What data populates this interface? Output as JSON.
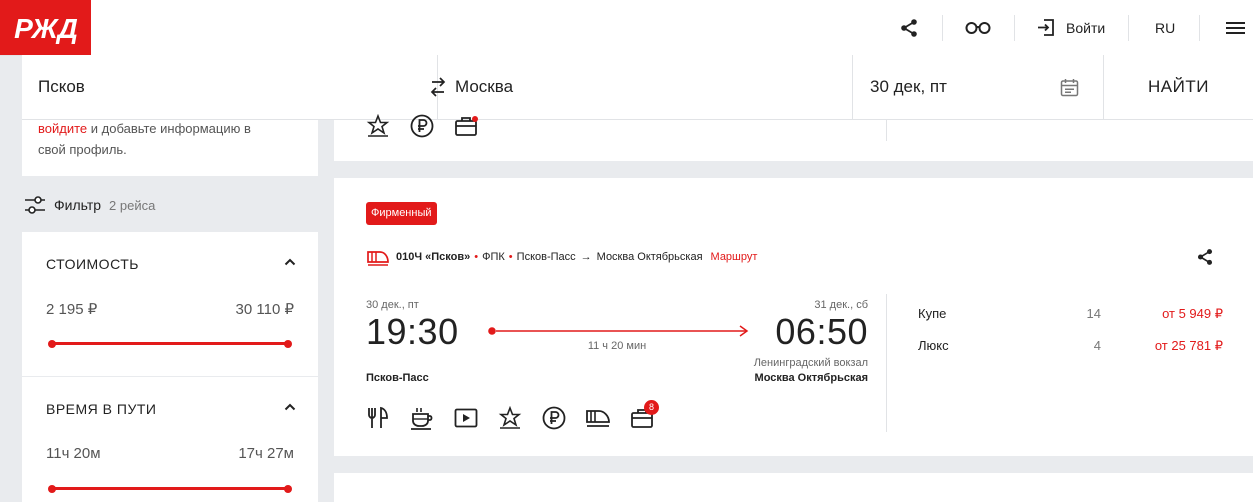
{
  "header": {
    "logo_text": "РЖД",
    "login_label": "Войти",
    "language": "RU"
  },
  "search": {
    "from": "Псков",
    "to": "Москва",
    "date": "30 дек, пт",
    "find_label": "НАЙТИ"
  },
  "sidebar": {
    "login_link": "войдите",
    "login_text": " и добавьте информацию в",
    "login_text2": "свой профиль.",
    "filter_label": "Фильтр",
    "filter_count": "2 рейса",
    "cost": {
      "title": "СТОИМОСТЬ",
      "min": "2 195 ₽",
      "max": "30 110 ₽"
    },
    "duration": {
      "title": "ВРЕМЯ В ПУТИ",
      "min": "11ч 20м",
      "max": "17ч 27м"
    }
  },
  "train": {
    "badge": "Фирменный",
    "number": "010Ч «Псков»",
    "carrier": "ФПК",
    "route_from": "Псков-Пасс",
    "route_to": "Москва Октябрьская",
    "route_link": "Маршрут",
    "dep_date": "30 дек., пт",
    "dep_time": "19:30",
    "arr_date": "31 дек., сб",
    "arr_time": "06:50",
    "duration": "11 ч 20 мин",
    "dep_station": "Псков-Пасс",
    "arr_terminal": "Ленинградский вокзал",
    "arr_station": "Москва Октябрьская",
    "notification_count": "8",
    "classes": [
      {
        "name": "Купе",
        "count": "14",
        "price": "от 5 949 ₽"
      },
      {
        "name": "Люкс",
        "count": "4",
        "price": "от 25 781 ₽"
      }
    ]
  },
  "icons": [
    "share-icon",
    "glasses-icon",
    "login-icon",
    "menu-icon",
    "swap-icon",
    "calendar-icon",
    "filter-icon",
    "chevron-up-icon",
    "train-icon",
    "restaurant-icon",
    "coffee-icon",
    "video-icon",
    "star-icon",
    "ruble-icon",
    "train-express-icon",
    "baggage-icon"
  ],
  "colors": {
    "accent": "#e21a1a",
    "background": "#e9ebee"
  }
}
